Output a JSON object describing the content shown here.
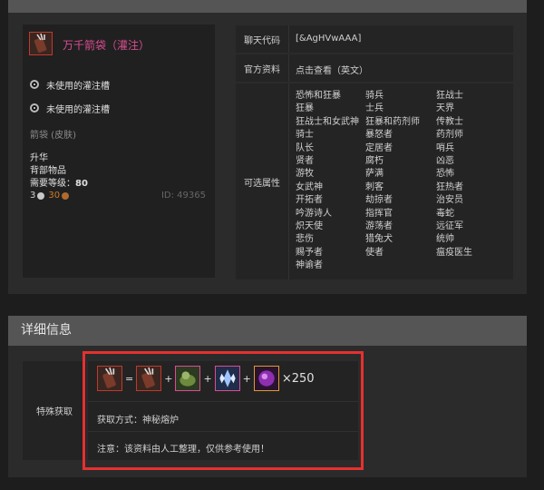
{
  "item": {
    "name": "万千箭袋（灌注）",
    "slots": [
      "未使用的灌注槽",
      "未使用的灌注槽"
    ],
    "skin": "箭袋 (皮肤)",
    "rarity": "升华",
    "type": "背部物品",
    "level_label": "需要等级：",
    "level_value": "80",
    "price_silver": "3",
    "price_copper": "30",
    "id": "ID: 49365"
  },
  "attributes": {
    "chat_code_label": "聊天代码",
    "chat_code": "[&AgHVwAAA]",
    "official_label": "官方资料",
    "official_link": "点击查看（英文）",
    "selectable_label": "可选属性",
    "columns": [
      [
        "恐怖和狂暴",
        "狂暴",
        "狂战士和女武神",
        "骑士",
        "队长",
        "贤者",
        "游牧",
        "女武神",
        "开拓者",
        "吟游诗人",
        "炽天使",
        "悲伤",
        "赐予者",
        "神谕者"
      ],
      [
        "骑兵",
        "士兵",
        "狂暴和药剂师",
        "暴怒者",
        "定居者",
        "腐朽",
        "萨满",
        "刺客",
        "劫掠者",
        "指挥官",
        "游荡者",
        "猎兔犬",
        "使者"
      ],
      [
        "狂战士",
        "天界",
        "传教士",
        "药剂师",
        "哨兵",
        "凶恶",
        "恐怖",
        "狂热者",
        "治安员",
        "毒蛇",
        "远征军",
        "统帅",
        "瘟疫医生"
      ]
    ]
  },
  "details": {
    "heading": "详细信息",
    "acquire_label": "特殊获取",
    "recipe_ops": [
      "=",
      "+",
      "+",
      "+"
    ],
    "recipe_icons": [
      "quiver-icon",
      "quiver-icon",
      "green-gift-icon",
      "crystal-shards-icon",
      "purple-orb-icon"
    ],
    "quantity": "×250",
    "method": "获取方式：神秘熔炉",
    "note": "注意：该资料由人工整理，仅供参考使用！"
  },
  "colors": {
    "item_name": "#d94d91",
    "highlight": "#e5312f",
    "silver_coin": "#c8c8c8",
    "copper_coin": "#b06a2e",
    "copper_text": "#d07a2a"
  }
}
